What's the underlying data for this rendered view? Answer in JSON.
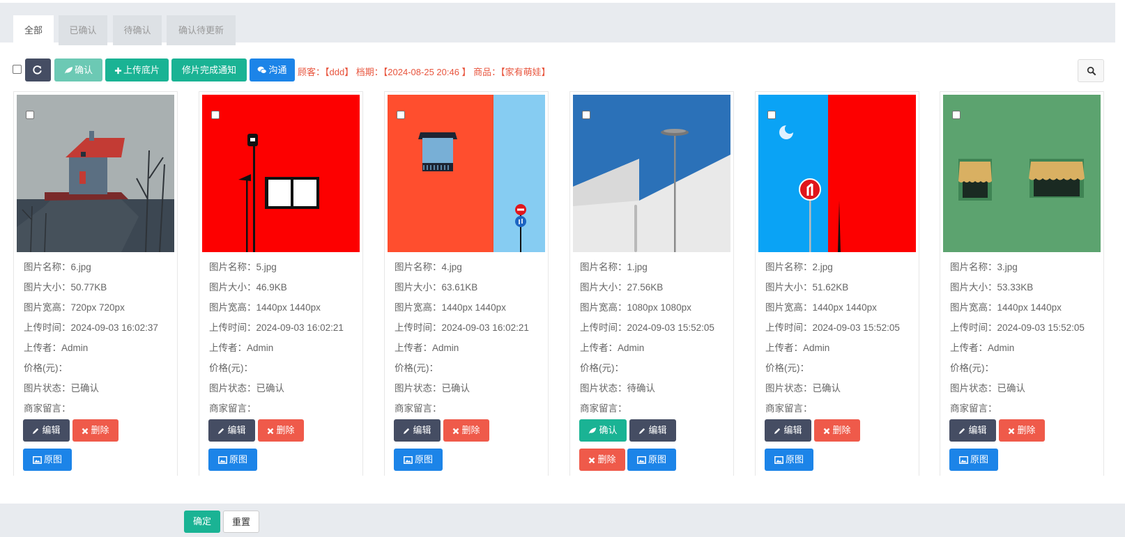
{
  "tabs": [
    {
      "label": "全部"
    },
    {
      "label": "已确认"
    },
    {
      "label": "待确认"
    },
    {
      "label": "确认待更新"
    }
  ],
  "toolbar": {
    "confirm_label": "确认",
    "upload_label": "上传底片",
    "notify_label": "修片完成通知",
    "chat_label": "沟通",
    "info": "顾客：【ddd】 档期：【2024-08-25 20:46 】 商品：【家有萌娃】"
  },
  "labels": {
    "name": "图片名称：",
    "size": "图片大小：",
    "dims": "图片宽高：",
    "time": "上传时间：",
    "uploader": "上传者：",
    "price": "价格(元)：",
    "status": "图片状态：",
    "note": "商家留言："
  },
  "buttons": {
    "edit": "编辑",
    "delete": "删除",
    "original": "原图",
    "confirm": "确认"
  },
  "cards": [
    {
      "name": "6.jpg",
      "size": "50.77KB",
      "dims": "720px 720px",
      "time": "2024-09-03 16:02:37",
      "uploader": "Admin",
      "price": "",
      "status": "已确认",
      "note": ""
    },
    {
      "name": "5.jpg",
      "size": "46.9KB",
      "dims": "1440px 1440px",
      "time": "2024-09-03 16:02:21",
      "uploader": "Admin",
      "price": "",
      "status": "已确认",
      "note": ""
    },
    {
      "name": "4.jpg",
      "size": "63.61KB",
      "dims": "1440px 1440px",
      "time": "2024-09-03 16:02:21",
      "uploader": "Admin",
      "price": "",
      "status": "已确认",
      "note": ""
    },
    {
      "name": "1.jpg",
      "size": "27.56KB",
      "dims": "1080px 1080px",
      "time": "2024-09-03 15:52:05",
      "uploader": "Admin",
      "price": "",
      "status": "待确认",
      "note": ""
    },
    {
      "name": "2.jpg",
      "size": "51.62KB",
      "dims": "1440px 1440px",
      "time": "2024-09-03 15:52:05",
      "uploader": "Admin",
      "price": "",
      "status": "已确认",
      "note": ""
    },
    {
      "name": "3.jpg",
      "size": "53.33KB",
      "dims": "1440px 1440px",
      "time": "2024-09-03 15:52:05",
      "uploader": "Admin",
      "price": "",
      "status": "已确认",
      "note": ""
    }
  ],
  "footer": {
    "ok_label": "确定",
    "reset_label": "重置"
  },
  "colors": {
    "dark": "#454d63",
    "green": "#1ab394",
    "blue": "#1c84e8",
    "red": "#ef5a4a",
    "info_red": "#e8553e"
  }
}
